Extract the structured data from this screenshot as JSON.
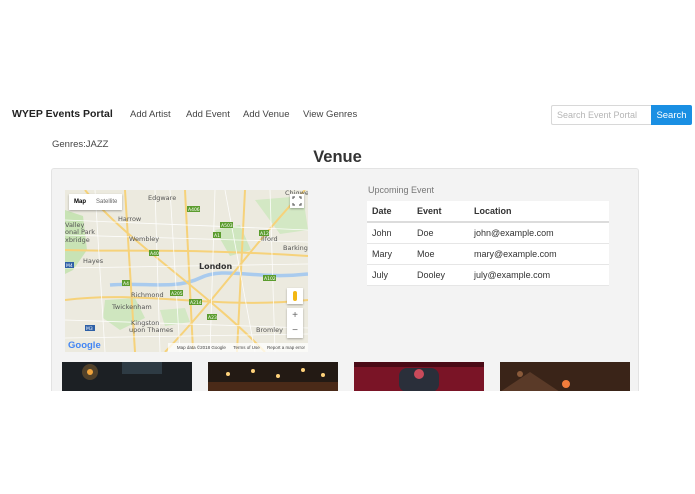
{
  "navbar": {
    "brand": "WYEP Events Portal",
    "links": [
      "Add Artist",
      "Add Event",
      "Add Venue",
      "View Genres"
    ],
    "search": {
      "placeholder": "Search Event Portal",
      "value": "",
      "button_label": "Search"
    }
  },
  "genres": "Genres:JAZZ",
  "page_title": "Venue",
  "map": {
    "map_type_active": "Map",
    "map_type_other": "Satellite",
    "zoom_in": "+",
    "zoom_out": "−",
    "place_labels": [
      "Edgware",
      "Harrow",
      "Wembley",
      "Hayes",
      "London",
      "Richmond",
      "Twickenham",
      "Kingston upon Thames",
      "Bromley",
      "Ilford",
      "Barking",
      "Chigwell",
      "Valley",
      "onal Park",
      "xbridge"
    ],
    "road_labels": [
      "A406",
      "A1",
      "A503",
      "A12",
      "A40",
      "A4",
      "A205",
      "A214",
      "A23",
      "A102",
      "M3",
      "M4"
    ],
    "footer": {
      "data": "Map data ©2018 Google",
      "terms": "Terms of Use",
      "report": "Report a map error"
    },
    "logo": "Google"
  },
  "events": {
    "label": "Upcoming Event",
    "headers": [
      "Date",
      "Event",
      "Location"
    ],
    "rows": [
      [
        "John",
        "Doe",
        "john@example.com"
      ],
      [
        "Mary",
        "Moe",
        "mary@example.com"
      ],
      [
        "July",
        "Dooley",
        "july@example.com"
      ]
    ]
  },
  "colors": {
    "accent": "#1a8fe3",
    "panel_bg": "#f3f3f3"
  }
}
